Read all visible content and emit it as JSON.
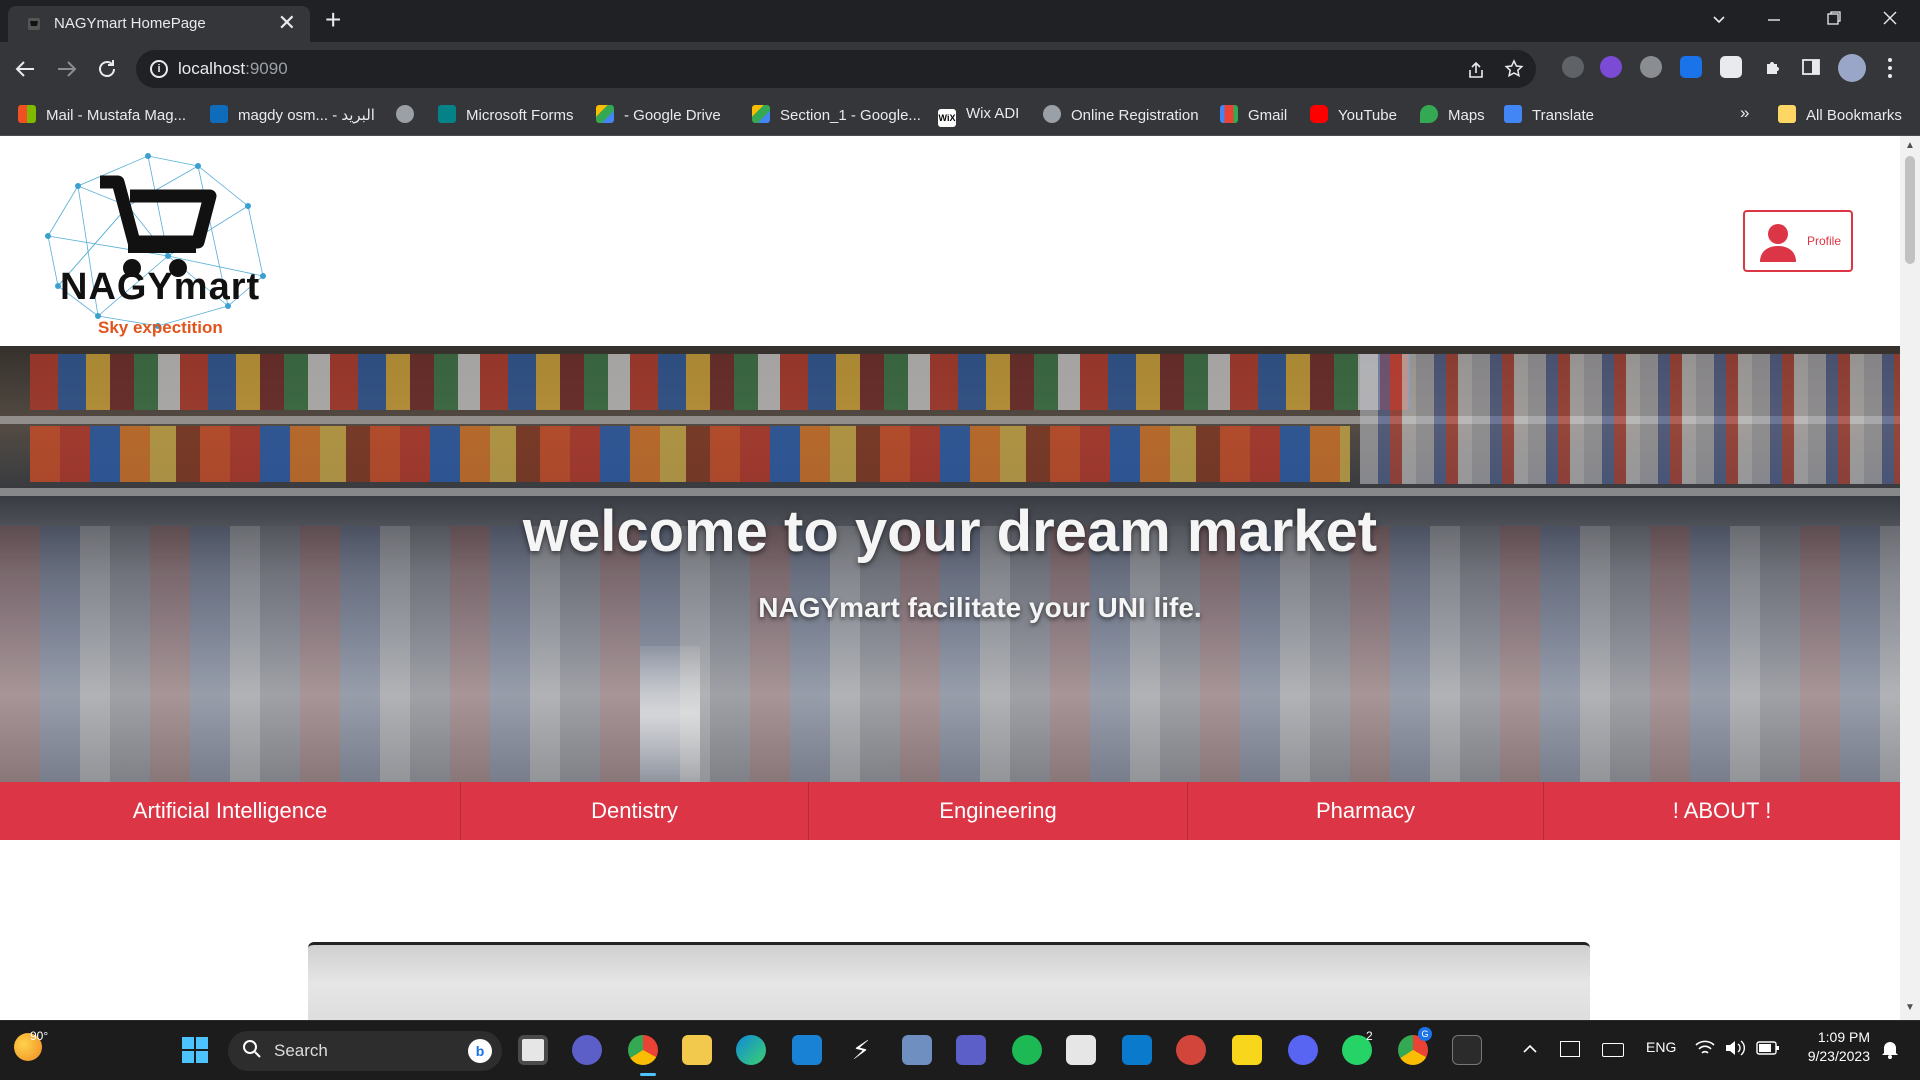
{
  "browser": {
    "tab_title": "NAGYmart HomePage",
    "close_glyph": "✕",
    "new_tab_glyph": "+",
    "url_host": "localhost",
    "url_port": ":9090",
    "bookmarks": [
      {
        "label": "Mail - Mustafa Mag...",
        "color": "#f25022"
      },
      {
        "label": "magdy osm... - البريد",
        "color": "#0f6cbd"
      },
      {
        "label": "",
        "color": "#9aa0a6"
      },
      {
        "label": "Microsoft Forms",
        "color": "#038387"
      },
      {
        "label": "- Google Drive",
        "color": "#fbbc04"
      },
      {
        "label": "Section_1 - Google...",
        "color": "#34a853"
      },
      {
        "label": "Wix ADI",
        "color": "#ffffff"
      },
      {
        "label": "Online Registration",
        "color": "#9aa0a6"
      },
      {
        "label": "Gmail",
        "color": "#ea4335"
      },
      {
        "label": "YouTube",
        "color": "#ff0000"
      },
      {
        "label": "Maps",
        "color": "#34a853"
      },
      {
        "label": "Translate",
        "color": "#4285f4"
      }
    ],
    "more_bookmarks_glyph": "»",
    "all_bookmarks": "All Bookmarks"
  },
  "site": {
    "brand_name": "NAGYmart",
    "tagline": "Sky expectition",
    "profile_label": "Profile",
    "hero_title": "welcome to your dream market",
    "hero_subtitle": "NAGYmart facilitate your UNI life.",
    "categories": [
      "Artificial Intelligence",
      "Dentistry",
      "Engineering",
      "Pharmacy",
      "! ABOUT !"
    ],
    "accent_color": "#dc3545",
    "tagline_color": "#e2541d"
  },
  "taskbar": {
    "temperature": "90°",
    "search_placeholder": "Search",
    "bing_glyph": "b",
    "language": "ENG",
    "time": "1:09 PM",
    "date": "9/23/2023",
    "whatsapp_badge": "2",
    "chrome_badge": "G"
  }
}
